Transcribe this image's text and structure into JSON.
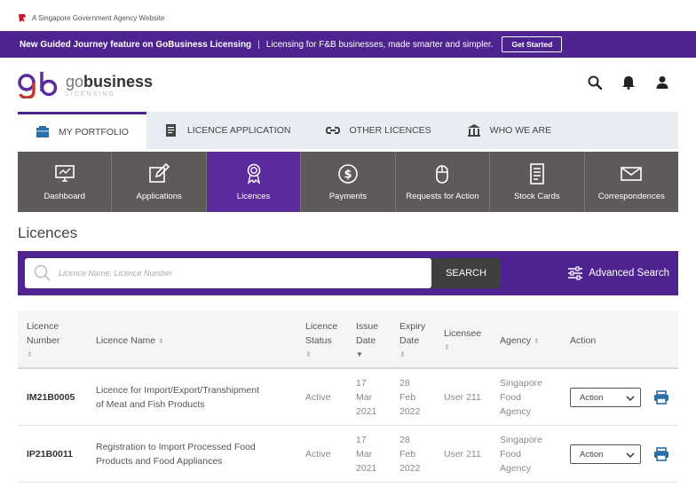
{
  "gov_banner": {
    "text": "A Singapore Government Agency Website"
  },
  "promo": {
    "headline": "New Guided Journey feature on GoBusiness Licensing",
    "separator": "|",
    "tagline": "Licensing for F&B businesses, made smarter and simpler.",
    "button_label": "Get Started"
  },
  "brand": {
    "name_go": "go",
    "name_biz": "business",
    "subtitle": "LICENSING"
  },
  "header_icons": [
    "search-icon",
    "bell-icon",
    "user-icon"
  ],
  "main_nav": [
    {
      "label": "MY PORTFOLIO",
      "icon": "portfolio-icon",
      "active": true
    },
    {
      "label": "LICENCE APPLICATION",
      "icon": "application-icon",
      "active": false
    },
    {
      "label": "OTHER LICENCES",
      "icon": "link-icon",
      "active": false
    },
    {
      "label": "WHO WE ARE",
      "icon": "building-icon",
      "active": false
    }
  ],
  "sub_nav": [
    {
      "label": "Dashboard",
      "icon": "monitor-icon",
      "active": false
    },
    {
      "label": "Applications",
      "icon": "edit-icon",
      "active": false
    },
    {
      "label": "Licences",
      "icon": "award-icon",
      "active": true
    },
    {
      "label": "Payments",
      "icon": "dollar-icon",
      "active": false
    },
    {
      "label": "Requests for Action",
      "icon": "mouse-icon",
      "active": false
    },
    {
      "label": "Stock Cards",
      "icon": "card-icon",
      "active": false
    },
    {
      "label": "Correspondences",
      "icon": "mail-icon",
      "active": false
    }
  ],
  "page_title": "Licences",
  "search": {
    "placeholder": "Licence Name, Licence Number",
    "button_label": "SEARCH",
    "advanced_label": "Advanced Search"
  },
  "table": {
    "headers": {
      "licence_number": [
        "Licence",
        "Number"
      ],
      "licence_name": "Licence Name",
      "licence_status": [
        "Licence",
        "Status"
      ],
      "issue_date": [
        "Issue",
        "Date"
      ],
      "expiry_date": [
        "Expiry",
        "Date"
      ],
      "licensee": "Licensee",
      "agency": "Agency",
      "action": "Action"
    },
    "rows": [
      {
        "licence_number": "IM21B0005",
        "licence_name": [
          "Licence for Import/Export/Transhipment",
          "of Meat and Fish Products"
        ],
        "status": "Active",
        "issue_date": [
          "17",
          "Mar",
          "2021"
        ],
        "expiry_date": [
          "28",
          "Feb",
          "2022"
        ],
        "licensee": "User 211",
        "agency": [
          "Singapore",
          "Food",
          "Agency"
        ],
        "action_label": "Action"
      },
      {
        "licence_number": "IP21B0011",
        "licence_name": [
          "Registration to Import Processed Food",
          "Products and Food Appliances"
        ],
        "status": "Active",
        "issue_date": [
          "17",
          "Mar",
          "2021"
        ],
        "expiry_date": [
          "28",
          "Feb",
          "2022"
        ],
        "licensee": "User 211",
        "agency": [
          "Singapore",
          "Food",
          "Agency"
        ],
        "action_label": "Action"
      }
    ]
  },
  "colors": {
    "brand_purple": "#4d2390",
    "active_tab": "#5b2a9c",
    "sub_nav_bg": "#5f5a5a",
    "print_icon": "#2b6ea8"
  }
}
